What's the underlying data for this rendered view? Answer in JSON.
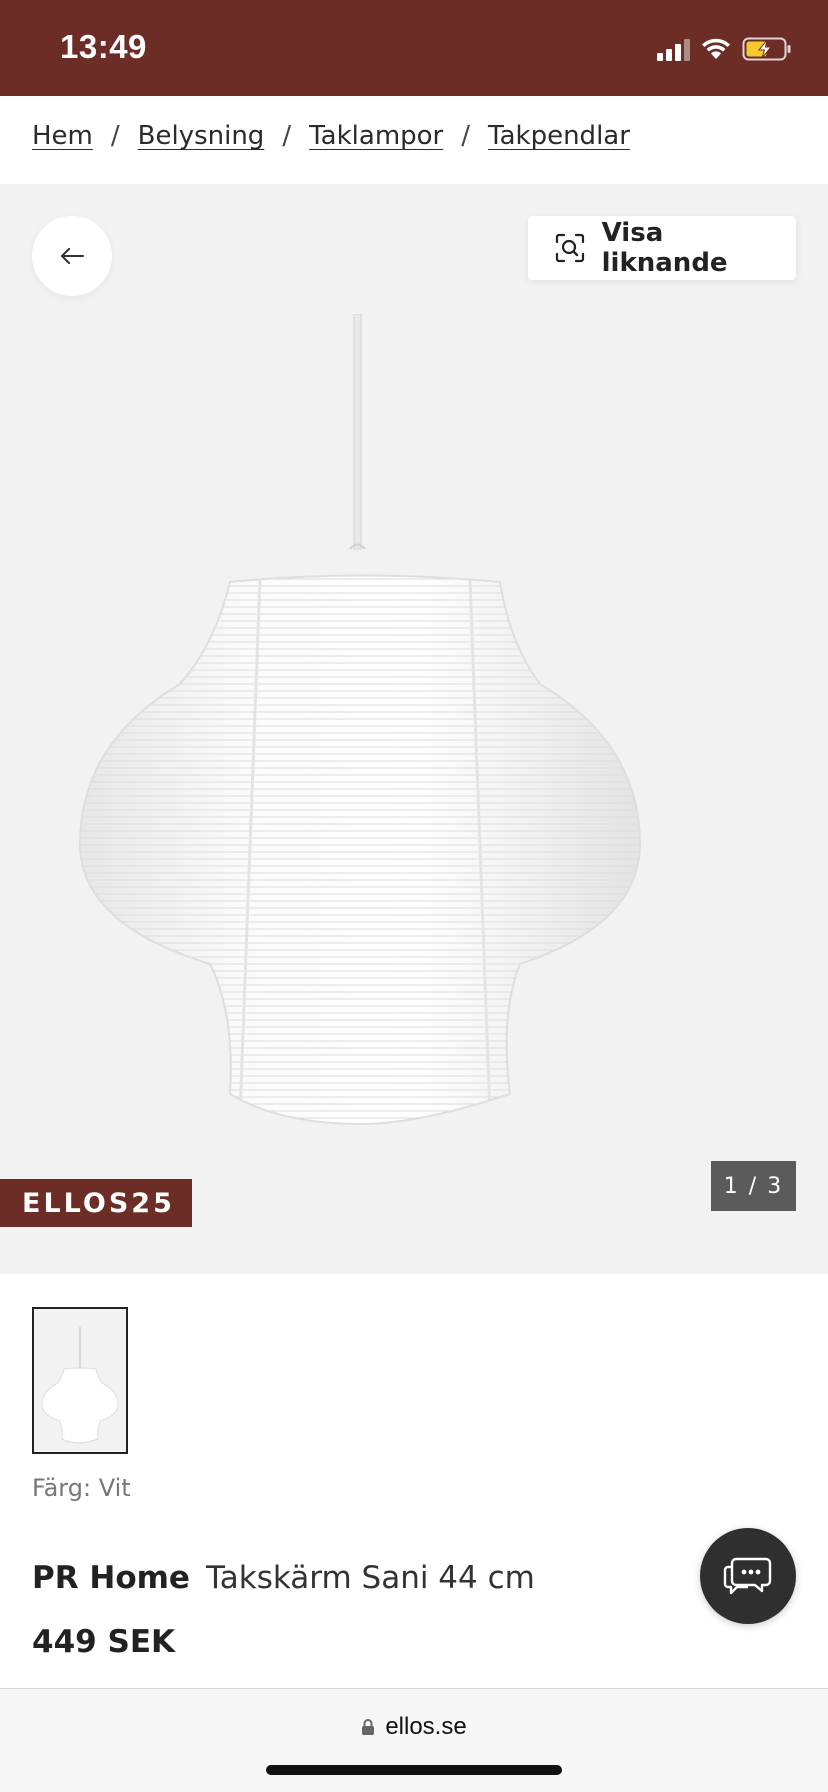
{
  "status_bar": {
    "time": "13:49",
    "icons": [
      "signal-icon",
      "wifi-icon",
      "battery-charging-icon"
    ],
    "background": "#6b2d26"
  },
  "breadcrumb": {
    "items": [
      "Hem",
      "Belysning",
      "Taklampor",
      "Takpendlar"
    ],
    "separator": "/"
  },
  "hero": {
    "similar_label": "Visa liknande",
    "promo_code": "ELLOS25",
    "image_counter": "1 / 3"
  },
  "product": {
    "color_label": "Färg: Vit",
    "brand": "PR Home",
    "name": "Takskärm Sani 44 cm",
    "price": "449 SEK"
  },
  "browser": {
    "url": "ellos.se"
  },
  "colors": {
    "brand_maroon": "#6b2d26",
    "hero_bg": "#f2f2f2",
    "chat_button": "#2f2f2f",
    "counter_bg": "#5b5b5b"
  }
}
